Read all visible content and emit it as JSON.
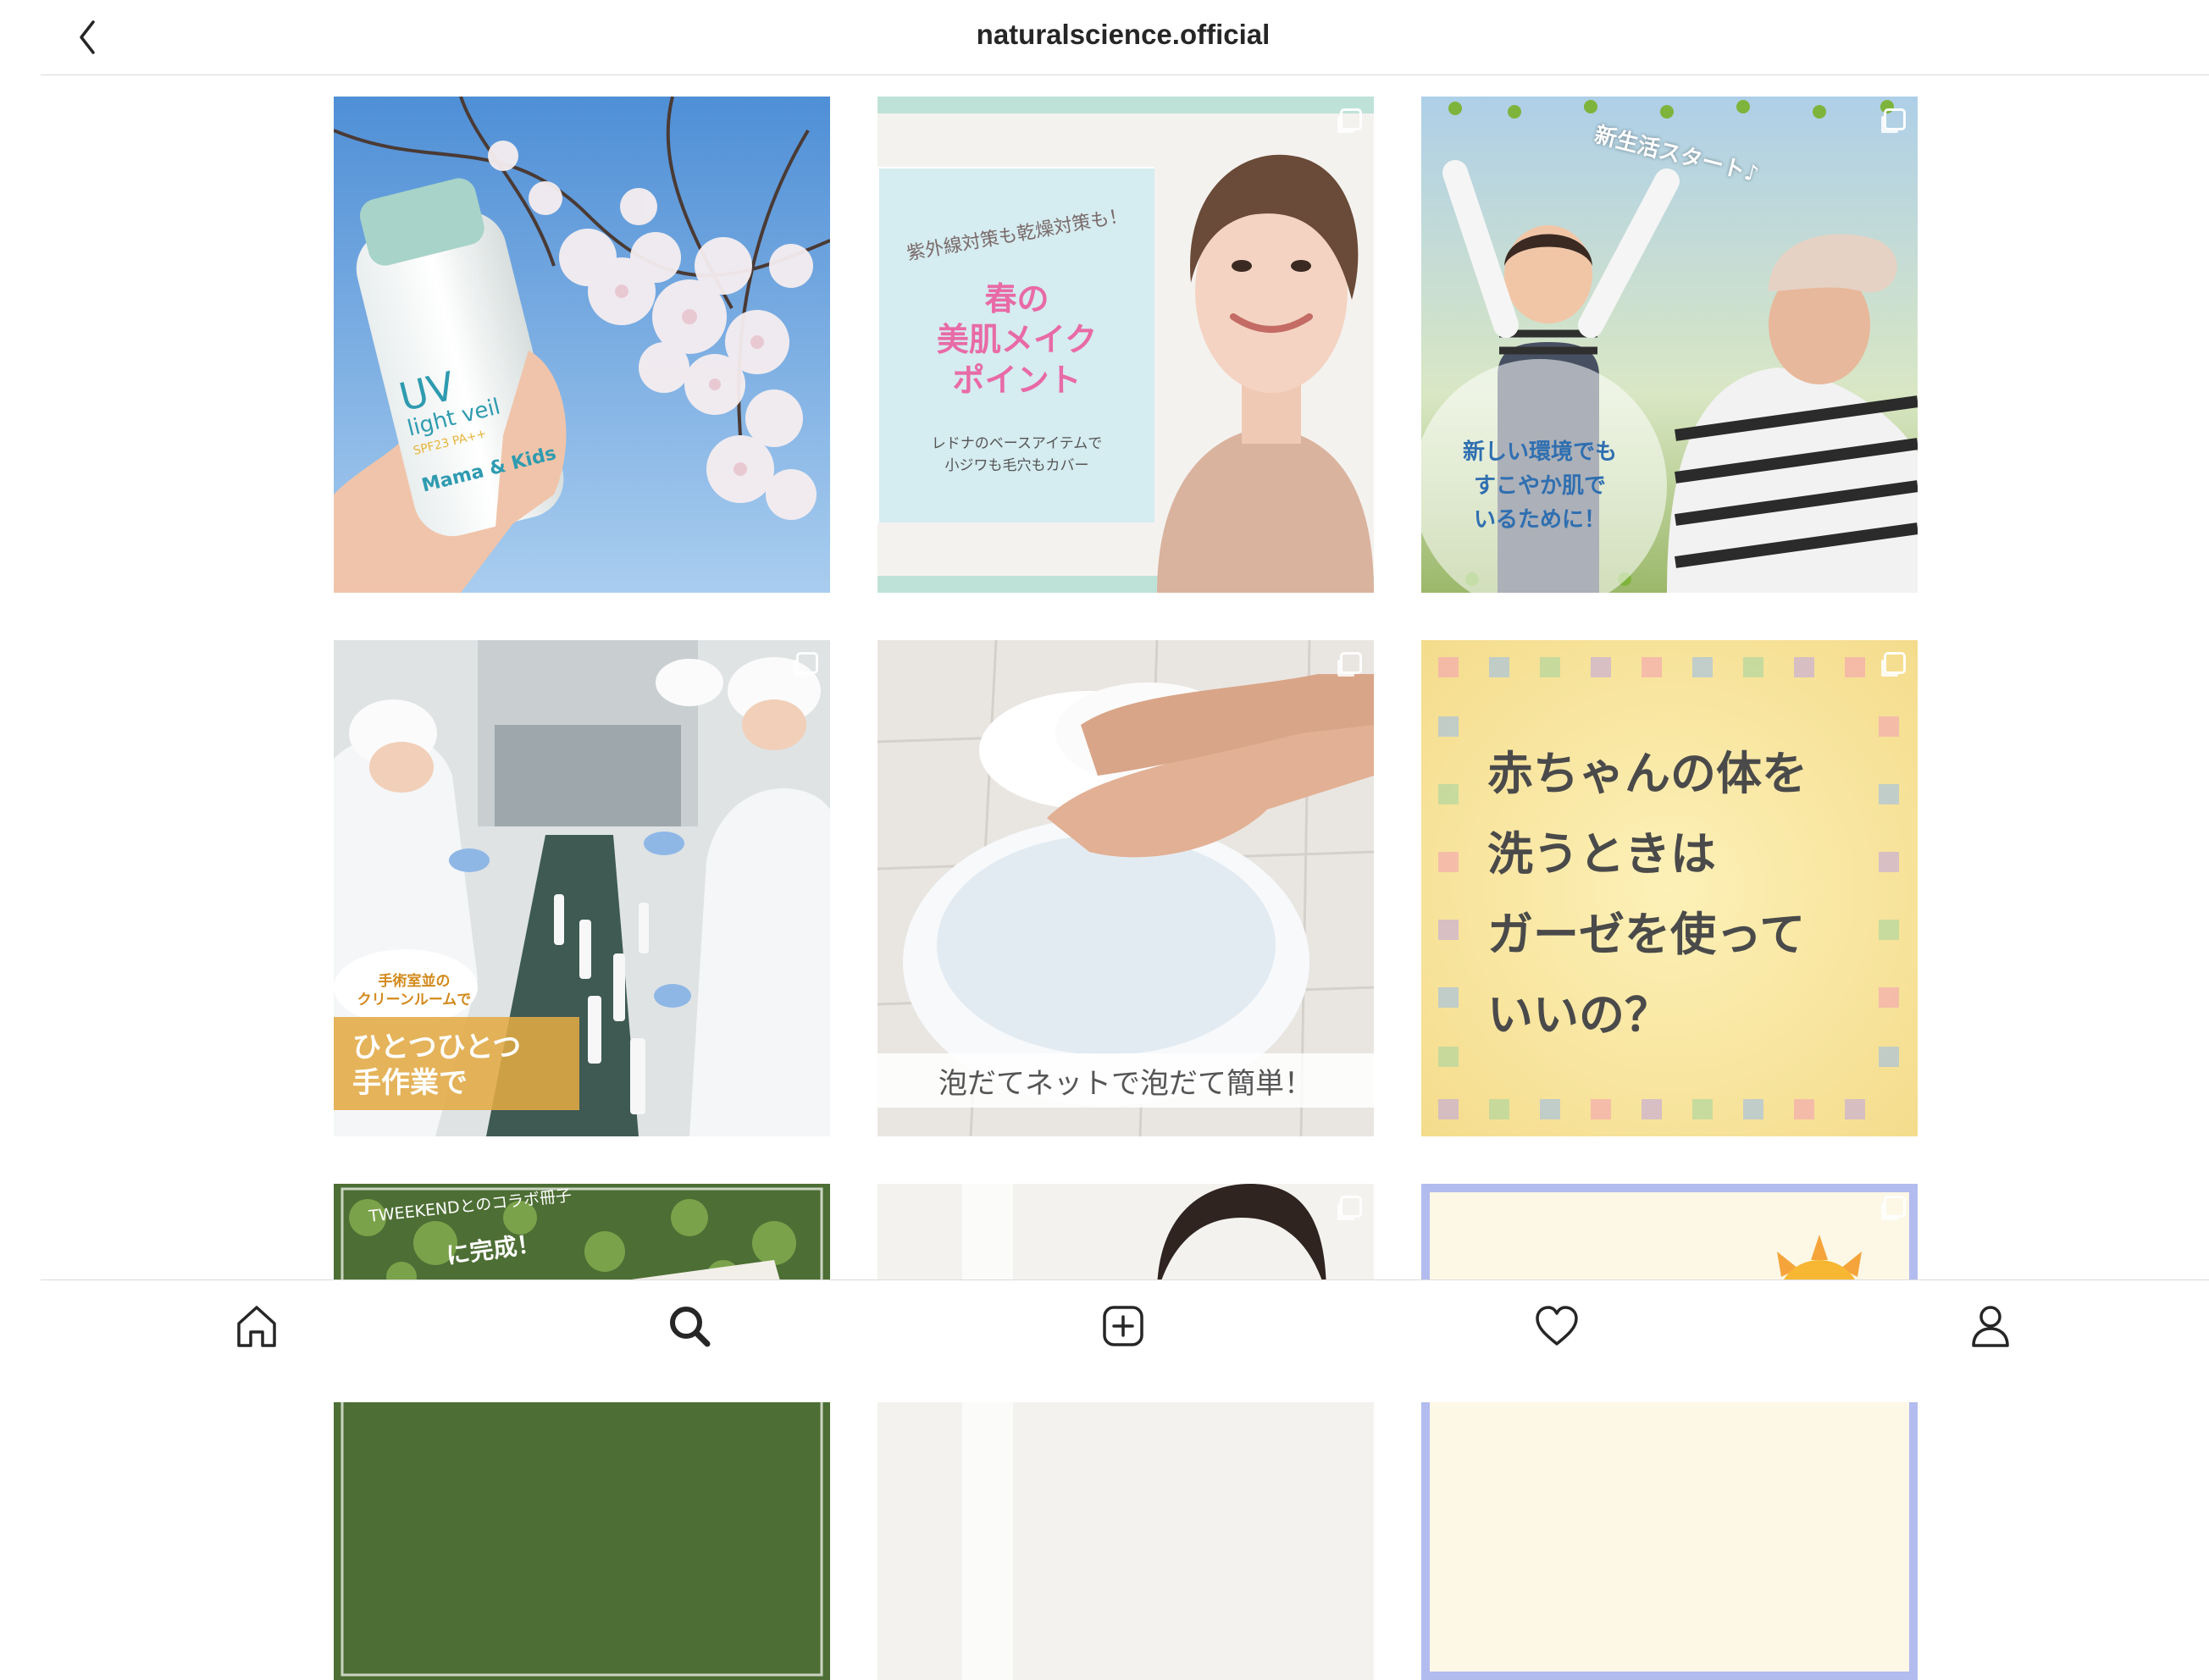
{
  "header": {
    "title": "naturalscience.official"
  },
  "posts": [
    {
      "label_lines": []
    },
    {
      "sub": "紫外線対策も乾燥対策も！",
      "title_lines": [
        "春の",
        "美肌メイク",
        "ポイント"
      ],
      "caption_lines": [
        "レドナのベースアイテムで",
        "小ジワも毛穴もカバー"
      ]
    },
    {
      "corner": "新生活スタート♪",
      "bubble_lines": [
        "新しい環境でも",
        "すこやか肌で",
        "いるために！"
      ]
    },
    {
      "bubble_lines": [
        "手術室並の",
        "クリーンルームで"
      ],
      "band_lines": [
        "ひとつひとつ",
        "手作業で"
      ]
    },
    {
      "caption": "泡だてネットで泡だて簡単！"
    },
    {
      "text_lines": [
        "赤ちゃんの体を",
        "洗うときは",
        "ガーゼを使って",
        "いいの？"
      ]
    },
    {
      "line1": "TWEEKENDとのコラボ冊子",
      "line2": "に完成！"
    },
    {},
    {}
  ],
  "product": {
    "uv": "UV",
    "light": "light veil",
    "spf": "SPF23 PA++",
    "brand": "Mama & Kids"
  },
  "nav": {
    "items": [
      "home",
      "search",
      "new-post",
      "activity",
      "profile"
    ],
    "active": "search"
  },
  "colors": {
    "accent_pink": "#e86aa6",
    "header_text": "#262626",
    "divider": "#dbdbdb"
  }
}
